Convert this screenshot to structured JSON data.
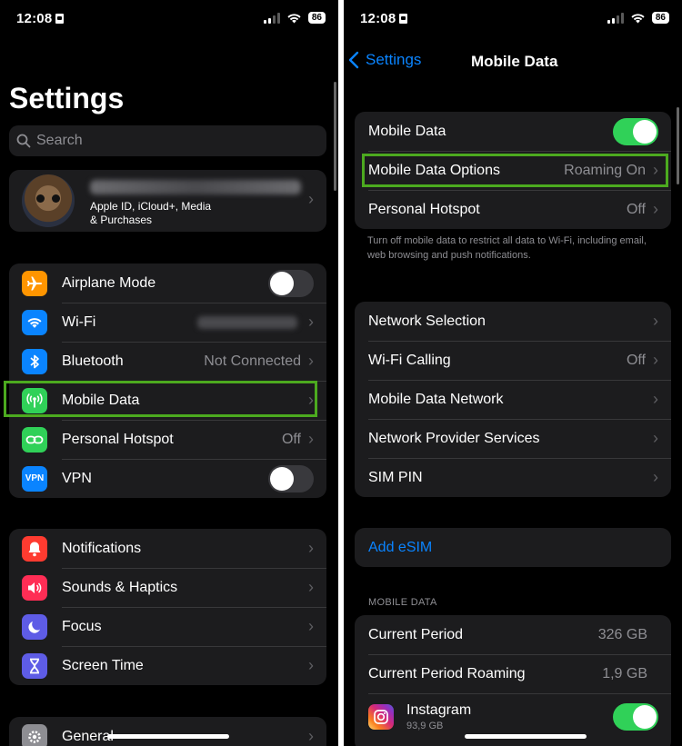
{
  "left": {
    "status": {
      "time": "12:08",
      "battery": "86"
    },
    "title": "Settings",
    "search": {
      "placeholder": "Search"
    },
    "profile": {
      "subtitle_line1": "Apple ID, iCloud+, Media",
      "subtitle_line2": "& Purchases",
      "avatar_icon": "groot-avatar-icon"
    },
    "group1": [
      {
        "label": "Airplane Mode",
        "icon": "airplane-icon",
        "color": "#ff9500",
        "toggle": "off"
      },
      {
        "label": "Wi-Fi",
        "icon": "wifi-icon",
        "color": "#0a84ff"
      },
      {
        "label": "Bluetooth",
        "icon": "bluetooth-icon",
        "color": "#0a84ff",
        "value": "Not Connected"
      },
      {
        "label": "Mobile Data",
        "icon": "antenna-icon",
        "color": "#30d158"
      },
      {
        "label": "Personal Hotspot",
        "icon": "hotspot-link-icon",
        "color": "#30d158",
        "value": "Off"
      },
      {
        "label": "VPN",
        "icon": "vpn-icon",
        "color": "#0a84ff",
        "toggle": "off",
        "badge": "VPN"
      }
    ],
    "group2": [
      {
        "label": "Notifications",
        "icon": "bell-icon",
        "color": "#ff3b30"
      },
      {
        "label": "Sounds & Haptics",
        "icon": "speaker-icon",
        "color": "#ff2d55"
      },
      {
        "label": "Focus",
        "icon": "moon-icon",
        "color": "#5e5ce6"
      },
      {
        "label": "Screen Time",
        "icon": "hourglass-icon",
        "color": "#5e5ce6"
      }
    ],
    "group3": [
      {
        "label": "General",
        "icon": "gear-icon",
        "color": "#8e8e93"
      }
    ]
  },
  "right": {
    "status": {
      "time": "12:08",
      "battery": "86"
    },
    "nav": {
      "back_label": "Settings",
      "title": "Mobile Data"
    },
    "group1": [
      {
        "label": "Mobile Data",
        "toggle": "on"
      },
      {
        "label": "Mobile Data Options",
        "value": "Roaming On"
      },
      {
        "label": "Personal Hotspot",
        "value": "Off"
      }
    ],
    "group1_footer": "Turn off mobile data to restrict all data to Wi-Fi, including email, web browsing and push notifications.",
    "group2": [
      {
        "label": "Network Selection"
      },
      {
        "label": "Wi-Fi Calling",
        "value": "Off"
      },
      {
        "label": "Mobile Data Network"
      },
      {
        "label": "Network Provider Services"
      },
      {
        "label": "SIM PIN"
      }
    ],
    "add_esim": "Add eSIM",
    "section_header": "MOBILE DATA",
    "usage": [
      {
        "label": "Current Period",
        "value": "326 GB"
      },
      {
        "label": "Current Period Roaming",
        "value": "1,9 GB"
      }
    ],
    "apps": [
      {
        "label": "Instagram",
        "size": "93,9 GB",
        "toggle": "on",
        "icon": "instagram-icon"
      }
    ]
  },
  "colors": {
    "highlight": "#4caa1f",
    "link": "#0a84ff",
    "toggle_on": "#30d158"
  }
}
